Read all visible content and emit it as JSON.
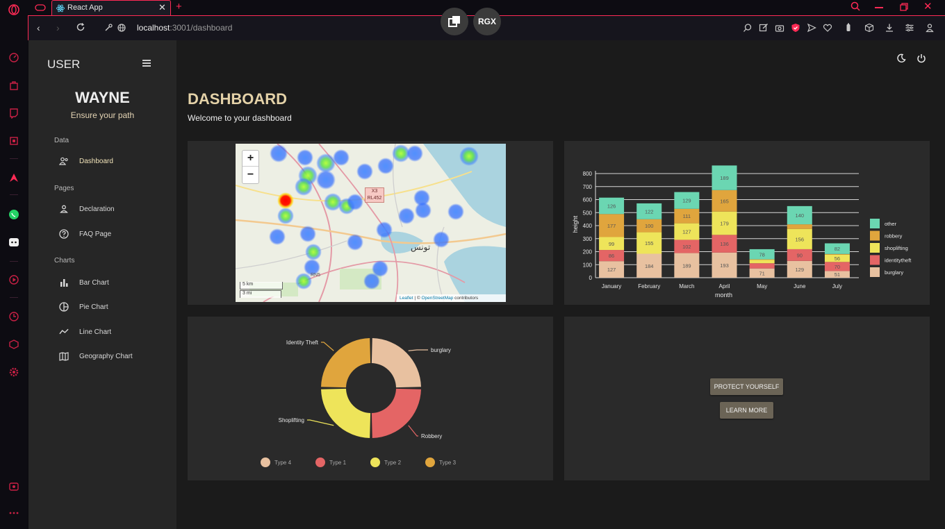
{
  "browser": {
    "tab_title": "React App",
    "url_host": "localhost",
    "url_rest": ":3001/dashboard",
    "overlay_badge": "RGX"
  },
  "sidebar": {
    "header": "USER",
    "profile_name": "WAYNE",
    "profile_tagline": "Ensure your path",
    "sections": [
      {
        "title": "Data",
        "items": [
          {
            "label": "Dashboard",
            "icon": "people-icon"
          }
        ]
      },
      {
        "title": "Pages",
        "items": [
          {
            "label": "Declaration",
            "icon": "person-icon"
          },
          {
            "label": "FAQ Page",
            "icon": "help-icon"
          }
        ]
      },
      {
        "title": "Charts",
        "items": [
          {
            "label": "Bar Chart",
            "icon": "bar-chart-icon"
          },
          {
            "label": "Pie Chart",
            "icon": "pie-chart-icon"
          },
          {
            "label": "Line Chart",
            "icon": "line-chart-icon"
          },
          {
            "label": "Geography Chart",
            "icon": "map-icon"
          }
        ]
      }
    ]
  },
  "main": {
    "title": "DASHBOARD",
    "subtitle": "Welcome to your dashboard",
    "map": {
      "zoom_in": "+",
      "zoom_out": "−",
      "scale_km": "5 km",
      "scale_mi": "3 mi",
      "road_label": "X3\nRL452",
      "road_label_line1": "X3",
      "road_label_line2": "RL452",
      "attribution_leaflet": "Leaflet",
      "attribution_sep": "| ©",
      "attribution_osm": "OpenStreetMap",
      "attribution_tail": "contributors",
      "city_label": "تونس",
      "label_rns": "RN5"
    },
    "buttons": {
      "protect": "PROTECT YOURSELF",
      "learn": "LEARN MORE"
    }
  },
  "colors": {
    "other": "#6bd6b2",
    "robbery": "#e0a53d",
    "shoplifting": "#eee45a",
    "identitytheft": "#e46565",
    "burglary": "#e8c1a0"
  },
  "chart_data": [
    {
      "type": "bar",
      "stacked": true,
      "categories": [
        "January",
        "February",
        "March",
        "April",
        "May",
        "June",
        "July"
      ],
      "xlabel": "month",
      "ylabel": "height",
      "ylim": [
        0,
        800
      ],
      "yticks": [
        0,
        100,
        200,
        300,
        400,
        500,
        600,
        700,
        800
      ],
      "legend_position": "right",
      "series": [
        {
          "name": "burglary",
          "values": [
            127,
            184,
            189,
            193,
            71,
            129,
            51
          ]
        },
        {
          "name": "identitytheft",
          "values": [
            86,
            0,
            102,
            136,
            40,
            90,
            70
          ]
        },
        {
          "name": "shoplifting",
          "values": [
            99,
            165,
            127,
            179,
            25,
            156,
            56
          ]
        },
        {
          "name": "robbery",
          "values": [
            177,
            100,
            111,
            165,
            5,
            35,
            5
          ]
        },
        {
          "name": "other",
          "values": [
            126,
            122,
            129,
            189,
            78,
            140,
            82
          ]
        }
      ],
      "data_labels": {
        "burglary": [
          "127",
          "184",
          "189",
          "193",
          "71",
          "129",
          "51"
        ],
        "identitytheft": [
          "86",
          "",
          "102",
          "136",
          "",
          "90",
          "70"
        ],
        "shoplifting": [
          "99",
          "155",
          "127",
          "179",
          "",
          "156",
          "56"
        ],
        "robbery": [
          "177",
          "100",
          "111",
          "165",
          "",
          "",
          ""
        ],
        "other": [
          "126",
          "122",
          "129",
          "189",
          "78",
          "140",
          "82"
        ]
      }
    },
    {
      "type": "pie",
      "donut": true,
      "slices": [
        {
          "label": "burglary",
          "value": 25,
          "color": "#e8c1a0"
        },
        {
          "label": "Robbery",
          "value": 25,
          "color": "#e46565"
        },
        {
          "label": "Shoplifting",
          "value": 25,
          "color": "#eee45a"
        },
        {
          "label": "Identity Theft",
          "value": 25,
          "color": "#e0a53d"
        }
      ],
      "legend": [
        {
          "label": "Type 4",
          "color": "#e8c1a0"
        },
        {
          "label": "Type 1",
          "color": "#e46565"
        },
        {
          "label": "Type 2",
          "color": "#eee45a"
        },
        {
          "label": "Type 3",
          "color": "#e0a53d"
        }
      ],
      "legend_position": "bottom"
    }
  ]
}
